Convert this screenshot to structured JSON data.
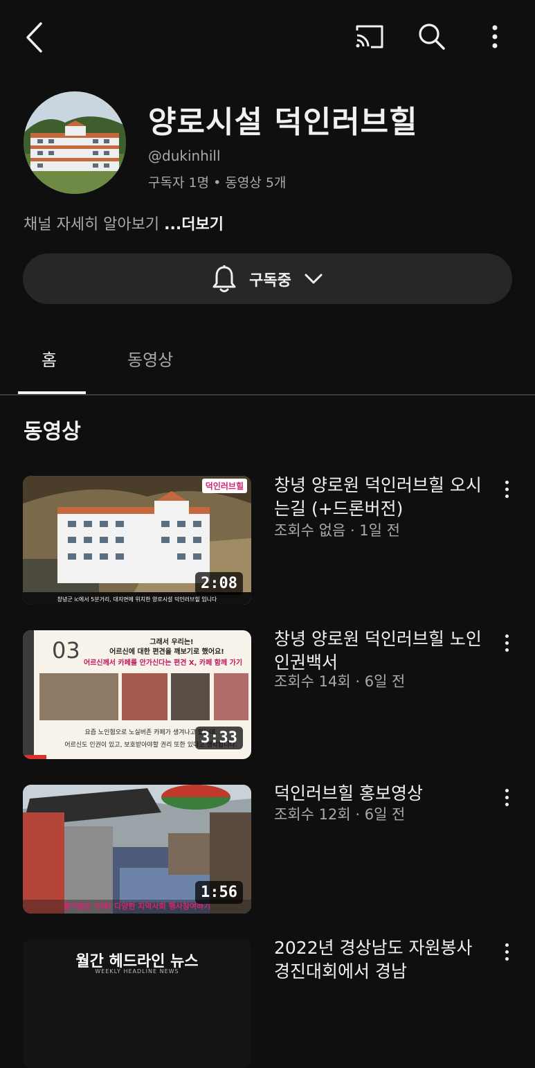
{
  "header": {
    "back_icon": "chevron-left-icon",
    "cast_icon": "cast-icon",
    "search_icon": "search-icon",
    "more_icon": "vertical-ellipsis-icon"
  },
  "channel": {
    "title": "양로시설 덕인러브힐",
    "handle": "@dukinhill",
    "stats": "구독자 1명 • 동영상 5개",
    "about": "채널 자세히 알아보기",
    "more_label": "...더보기"
  },
  "subscribe": {
    "label": "구독중",
    "bell_icon": "bell-icon",
    "chevron_icon": "chevron-down-icon"
  },
  "tabs": [
    {
      "label": "홈",
      "active": true
    },
    {
      "label": "동영상",
      "active": false
    }
  ],
  "section": {
    "title": "동영상"
  },
  "videos": [
    {
      "title": "창녕 양로원 덕인러브힐 오시는길 (+드론버전)",
      "meta": "조회수 없음 · 1일 전",
      "duration": "2:08",
      "thumb_caption": "창녕군 ic에서 5분거리, 대지면에 위치한 양로시설 덕인러브힐 입니다",
      "thumb_brand": "덕인러브힐"
    },
    {
      "title": "창녕 양로원 덕인러브힐 노인인권백서",
      "meta": "조회수 14회 · 6일 전",
      "duration": "3:33",
      "thumb_num": "03",
      "thumb_head1": "그래서 우리는!",
      "thumb_head2": "어르신에 대한 편견을 깨보기로 했어요!",
      "thumb_head3": "어르신께서 카페를 안가신다는 편견 X, 카페 함께 가기",
      "thumb_foot1": "요즘 노인혐오로 노실버존 카페가 생겨나고 있는데,",
      "thumb_foot2": "어르신도 인권이 있고, 보호받아야할 권리 또한 있다고 생각합니다."
    },
    {
      "title": "덕인러브힐 홍보영상",
      "meta": "조회수 12회 · 6일 전",
      "duration": "1:56",
      "thumb_caption": "즐거움은 두배! 다양한 지역사회 행사참여하기"
    },
    {
      "title": "2022년 경상남도 자원봉사 경진대회에서 경남",
      "meta": "",
      "duration": "",
      "thumb_head1": "월간 헤드라인 뉴스",
      "thumb_head2": "WEEKLY HEADLINE NEWS"
    }
  ],
  "colors": {
    "background": "#0f0f0f",
    "surface": "#272727",
    "text": "#f1f1f1",
    "secondary": "#aaaaaa"
  }
}
